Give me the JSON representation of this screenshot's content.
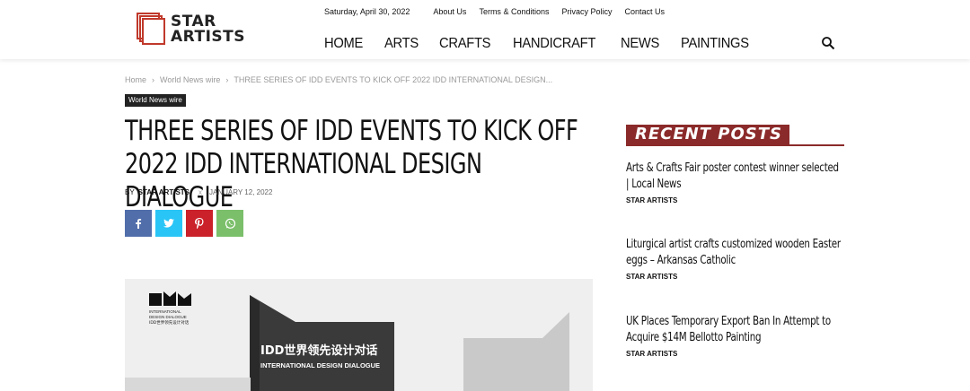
{
  "header": {
    "logo_line1": "STAR",
    "logo_line2": "ARTISTS",
    "date": "Saturday, April 30, 2022",
    "top_links": [
      "About Us",
      "Terms & Conditions",
      "Privacy Policy",
      "Contact Us"
    ],
    "nav": [
      "HOME",
      "ARTS",
      "CRAFTS",
      "HANDICRAFT",
      "NEWS",
      "PAINTINGS"
    ]
  },
  "breadcrumb": {
    "home": "Home",
    "category": "World News wire",
    "current": "THREE SERIES OF IDD EVENTS TO KICK OFF 2022 IDD INTERNATIONAL DESIGN..."
  },
  "article": {
    "category_badge": "World News wire",
    "title_line1": "THREE SERIES OF IDD EVENTS TO KICK OFF",
    "title_line2": "2022 IDD INTERNATIONAL DESIGN DIALOGUE",
    "by": "BY",
    "author": "STAR ARTISTS",
    "sep": "x",
    "date": "JANUARY 12, 2022",
    "share": {
      "facebook": "f",
      "twitter": "t",
      "pinterest": "p",
      "whatsapp": "w"
    },
    "image": {
      "logo_line1": "INTERNATIONAL",
      "logo_line2": "DESIGN DIALOGUE",
      "logo_line3": "IDD世界领先设计对话",
      "headline_cn": "IDD世界领先设计对话",
      "headline_en": "INTERNATIONAL DESIGN DIALOGUE"
    }
  },
  "sidebar": {
    "heading": "RECENT POSTS",
    "posts": [
      {
        "title": "Arts & Crafts Fair poster contest winner selected | Local News",
        "author": "STAR ARTISTS"
      },
      {
        "title": "Liturgical artist crafts customized wooden Easter eggs – Arkansas Catholic",
        "author": "STAR ARTISTS"
      },
      {
        "title": "UK Places Temporary Export Ban In Attempt to Acquire $14M Bellotto Painting",
        "author": "STAR ARTISTS"
      }
    ]
  },
  "colors": {
    "accent": "#8b2a2a",
    "logo_red": "#c0392b"
  }
}
